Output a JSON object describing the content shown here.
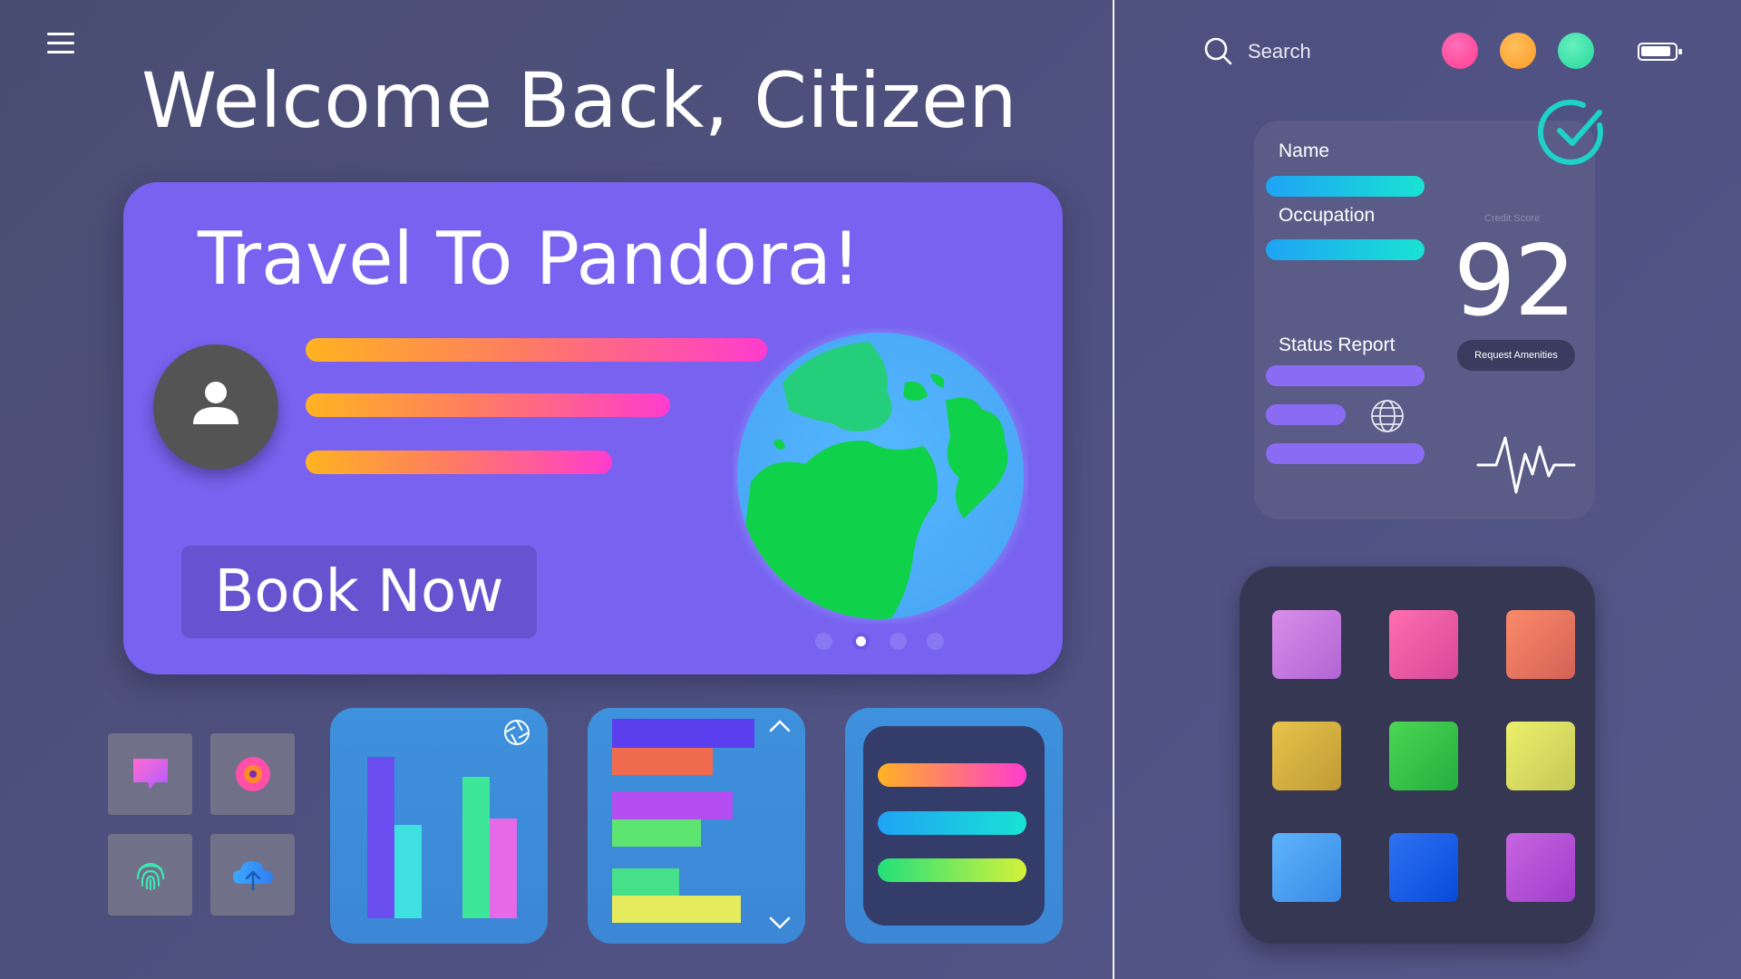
{
  "header": {
    "welcome": "Welcome Back, Citizen"
  },
  "hero": {
    "title": "Travel To Pandora!",
    "book_button": "Book Now",
    "carousel": {
      "count": 4,
      "active_index": 1
    }
  },
  "quick_tiles": [
    "chat-icon",
    "record-icon",
    "fingerprint-icon",
    "cloud-upload-icon"
  ],
  "search": {
    "label": "Search"
  },
  "status_dots": [
    "#ff4fa0",
    "#ffab3c",
    "#3fe1a6"
  ],
  "profile": {
    "name_label": "Name",
    "occupation_label": "Occupation",
    "status_label": "Status Report",
    "credit_label": "Credit Score",
    "credit_score": "92",
    "request_button": "Request Amenities"
  },
  "colors": {
    "hero_bg": "#7862ef",
    "accent_gradient": [
      "#ffb321",
      "#ff3ccf"
    ],
    "cyan_gradient": [
      "#1fa3f5",
      "#19e3d3"
    ],
    "violet_bar": "#8a6cf4"
  },
  "apps": [
    {
      "name": "app-pink-violet",
      "color": "#d98de8"
    },
    {
      "name": "app-pink",
      "color": "#ff6fae"
    },
    {
      "name": "app-coral",
      "color": "#fb8a6a"
    },
    {
      "name": "app-gold",
      "color": "#e8c34a"
    },
    {
      "name": "app-green",
      "color": "#4cd653"
    },
    {
      "name": "app-lime",
      "color": "#ecf06b"
    },
    {
      "name": "app-sky",
      "color": "#5fb3fb"
    },
    {
      "name": "app-blue",
      "color": "#2f72f0"
    },
    {
      "name": "app-purple",
      "color": "#c765e0"
    }
  ]
}
